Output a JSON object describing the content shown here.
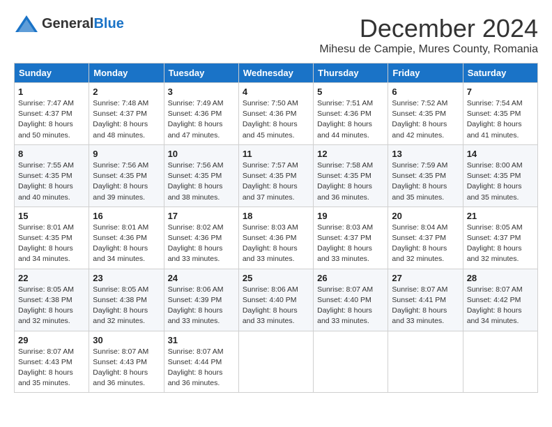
{
  "logo": {
    "general": "General",
    "blue": "Blue"
  },
  "header": {
    "month": "December 2024",
    "location": "Mihesu de Campie, Mures County, Romania"
  },
  "weekdays": [
    "Sunday",
    "Monday",
    "Tuesday",
    "Wednesday",
    "Thursday",
    "Friday",
    "Saturday"
  ],
  "weeks": [
    [
      {
        "day": "1",
        "sunrise": "7:47 AM",
        "sunset": "4:37 PM",
        "daylight": "8 hours and 50 minutes."
      },
      {
        "day": "2",
        "sunrise": "7:48 AM",
        "sunset": "4:37 PM",
        "daylight": "8 hours and 48 minutes."
      },
      {
        "day": "3",
        "sunrise": "7:49 AM",
        "sunset": "4:36 PM",
        "daylight": "8 hours and 47 minutes."
      },
      {
        "day": "4",
        "sunrise": "7:50 AM",
        "sunset": "4:36 PM",
        "daylight": "8 hours and 45 minutes."
      },
      {
        "day": "5",
        "sunrise": "7:51 AM",
        "sunset": "4:36 PM",
        "daylight": "8 hours and 44 minutes."
      },
      {
        "day": "6",
        "sunrise": "7:52 AM",
        "sunset": "4:35 PM",
        "daylight": "8 hours and 42 minutes."
      },
      {
        "day": "7",
        "sunrise": "7:54 AM",
        "sunset": "4:35 PM",
        "daylight": "8 hours and 41 minutes."
      }
    ],
    [
      {
        "day": "8",
        "sunrise": "7:55 AM",
        "sunset": "4:35 PM",
        "daylight": "8 hours and 40 minutes."
      },
      {
        "day": "9",
        "sunrise": "7:56 AM",
        "sunset": "4:35 PM",
        "daylight": "8 hours and 39 minutes."
      },
      {
        "day": "10",
        "sunrise": "7:56 AM",
        "sunset": "4:35 PM",
        "daylight": "8 hours and 38 minutes."
      },
      {
        "day": "11",
        "sunrise": "7:57 AM",
        "sunset": "4:35 PM",
        "daylight": "8 hours and 37 minutes."
      },
      {
        "day": "12",
        "sunrise": "7:58 AM",
        "sunset": "4:35 PM",
        "daylight": "8 hours and 36 minutes."
      },
      {
        "day": "13",
        "sunrise": "7:59 AM",
        "sunset": "4:35 PM",
        "daylight": "8 hours and 35 minutes."
      },
      {
        "day": "14",
        "sunrise": "8:00 AM",
        "sunset": "4:35 PM",
        "daylight": "8 hours and 35 minutes."
      }
    ],
    [
      {
        "day": "15",
        "sunrise": "8:01 AM",
        "sunset": "4:35 PM",
        "daylight": "8 hours and 34 minutes."
      },
      {
        "day": "16",
        "sunrise": "8:01 AM",
        "sunset": "4:36 PM",
        "daylight": "8 hours and 34 minutes."
      },
      {
        "day": "17",
        "sunrise": "8:02 AM",
        "sunset": "4:36 PM",
        "daylight": "8 hours and 33 minutes."
      },
      {
        "day": "18",
        "sunrise": "8:03 AM",
        "sunset": "4:36 PM",
        "daylight": "8 hours and 33 minutes."
      },
      {
        "day": "19",
        "sunrise": "8:03 AM",
        "sunset": "4:37 PM",
        "daylight": "8 hours and 33 minutes."
      },
      {
        "day": "20",
        "sunrise": "8:04 AM",
        "sunset": "4:37 PM",
        "daylight": "8 hours and 32 minutes."
      },
      {
        "day": "21",
        "sunrise": "8:05 AM",
        "sunset": "4:37 PM",
        "daylight": "8 hours and 32 minutes."
      }
    ],
    [
      {
        "day": "22",
        "sunrise": "8:05 AM",
        "sunset": "4:38 PM",
        "daylight": "8 hours and 32 minutes."
      },
      {
        "day": "23",
        "sunrise": "8:05 AM",
        "sunset": "4:38 PM",
        "daylight": "8 hours and 32 minutes."
      },
      {
        "day": "24",
        "sunrise": "8:06 AM",
        "sunset": "4:39 PM",
        "daylight": "8 hours and 33 minutes."
      },
      {
        "day": "25",
        "sunrise": "8:06 AM",
        "sunset": "4:40 PM",
        "daylight": "8 hours and 33 minutes."
      },
      {
        "day": "26",
        "sunrise": "8:07 AM",
        "sunset": "4:40 PM",
        "daylight": "8 hours and 33 minutes."
      },
      {
        "day": "27",
        "sunrise": "8:07 AM",
        "sunset": "4:41 PM",
        "daylight": "8 hours and 33 minutes."
      },
      {
        "day": "28",
        "sunrise": "8:07 AM",
        "sunset": "4:42 PM",
        "daylight": "8 hours and 34 minutes."
      }
    ],
    [
      {
        "day": "29",
        "sunrise": "8:07 AM",
        "sunset": "4:43 PM",
        "daylight": "8 hours and 35 minutes."
      },
      {
        "day": "30",
        "sunrise": "8:07 AM",
        "sunset": "4:43 PM",
        "daylight": "8 hours and 36 minutes."
      },
      {
        "day": "31",
        "sunrise": "8:07 AM",
        "sunset": "4:44 PM",
        "daylight": "8 hours and 36 minutes."
      },
      null,
      null,
      null,
      null
    ]
  ]
}
